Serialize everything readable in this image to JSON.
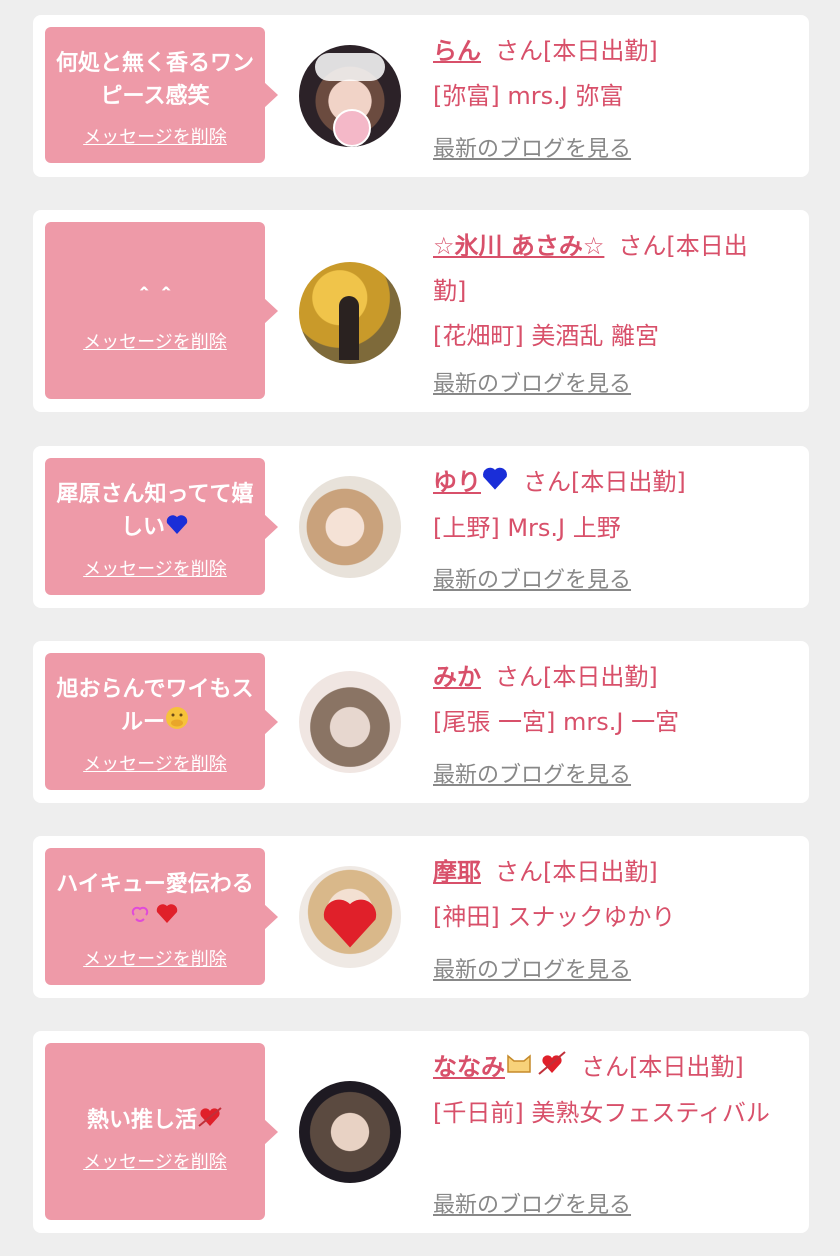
{
  "colors": {
    "page_bg": "#eeeeee",
    "bubble": "#ee9aa8",
    "accent_text": "#d8506a",
    "muted_link": "#888888"
  },
  "cards": [
    {
      "message": "何処と無く香るワンピース感笑",
      "delete_label": "メッセージを削除",
      "name": "らん",
      "status": "さん[本日出勤]",
      "shop": "[弥富] mrs.J 弥富",
      "blog_link": "最新のブログを見る"
    },
    {
      "message": "＾＾",
      "delete_label": "メッセージを削除",
      "name": "☆氷川 あさみ☆",
      "status": "さん[本日出勤]",
      "shop": "[花畑町] 美酒乱 離宮",
      "blog_link": "最新のブログを見る"
    },
    {
      "message": "犀原さん知ってて嬉しい",
      "message_icon": "blue-heart-icon",
      "delete_label": "メッセージを削除",
      "name": "ゆり",
      "name_icon": "blue-heart-icon",
      "status": "さん[本日出勤]",
      "shop": "[上野] Mrs.J 上野",
      "blog_link": "最新のブログを見る"
    },
    {
      "message": "旭おらんでワイもスルー",
      "message_icon": "hand-over-mouth-emoji-icon",
      "delete_label": "メッセージを削除",
      "name": "みか",
      "status": "さん[本日出勤]",
      "shop": "[尾張 一宮] mrs.J 一宮",
      "blog_link": "最新のブログを見る"
    },
    {
      "message": "ハイキュー愛伝わる",
      "message_icon": "heart-eyes-and-red-heart-icon",
      "delete_label": "メッセージを削除",
      "name": "摩耶",
      "status": "さん[本日出勤]",
      "shop": "[神田] スナックゆかり",
      "blog_link": "最新のブログを見る"
    },
    {
      "message": "熱い推し活",
      "message_icon": "heart-with-arrow-icon",
      "delete_label": "メッセージを削除",
      "name": "ななみ",
      "name_icon": "cat-and-heart-arrow-icon",
      "status": "さん[本日出勤]",
      "shop": "[千日前] 美熟女フェスティバル",
      "blog_link": "最新のブログを見る"
    }
  ]
}
